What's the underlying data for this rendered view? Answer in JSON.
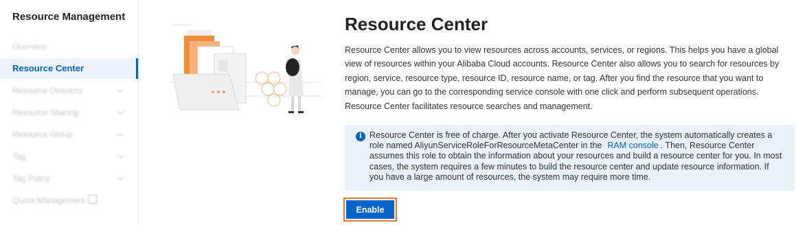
{
  "sidebar": {
    "title": "Resource Management",
    "items": [
      {
        "label": "Overview",
        "active": false,
        "expandable": false
      },
      {
        "label": "Resource Center",
        "active": true,
        "expandable": false
      },
      {
        "label": "Resource Directory",
        "active": false,
        "expandable": true
      },
      {
        "label": "Resource Sharing",
        "active": false,
        "expandable": true
      },
      {
        "label": "Resource Group",
        "active": false,
        "expandable": true
      },
      {
        "label": "Tag",
        "active": false,
        "expandable": true
      },
      {
        "label": "Tag Policy",
        "active": false,
        "expandable": true
      },
      {
        "label": "Quota Management",
        "active": false,
        "expandable": false,
        "external_icon": "external-link-icon"
      }
    ]
  },
  "main": {
    "title": "Resource Center",
    "description": "Resource Center allows you to view resources across accounts, services, or regions. This helps you have a global view of resources within your Alibaba Cloud accounts. Resource Center also allows you to search for resources by region, service, resource type, resource ID, resource name, or tag. After you find the resource that you want to manage, you can go to the corresponding service console with one click and perform subsequent operations. Resource Center facilitates resource searches and management.",
    "notice": {
      "icon": "info-icon",
      "text_before": "Resource Center is free of charge. After you activate Resource Center, the system automatically creates a role named AliyunServiceRoleForResourceMetaCenter in the",
      "link_text": "RAM console",
      "text_after": ". Then, Resource Center assumes this role to obtain the information about your resources and build a resource center for you. In most cases, the system requires a few minutes to build the resource center and update resource information. If you have a large amount of resources, the system may require more time."
    },
    "enable_button": "Enable"
  },
  "colors": {
    "accent": "#0064c8",
    "highlight_border": "#e6762f",
    "notice_bg": "#ebf1fa",
    "illustration_orange": "#f28c3a"
  }
}
